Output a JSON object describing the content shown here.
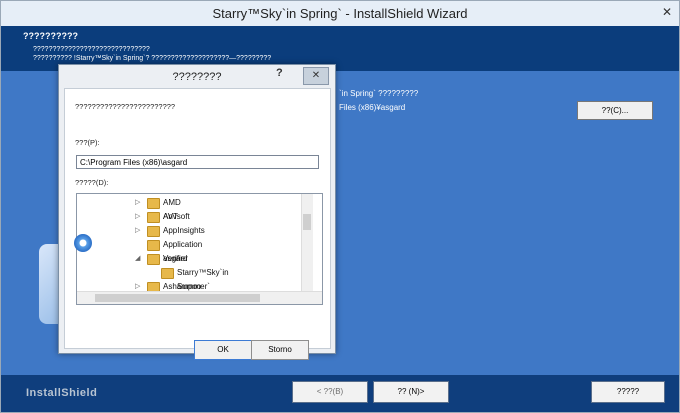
{
  "window": {
    "title": "Starry™Sky`in Spring` - InstallShield Wizard",
    "close_label": "✕"
  },
  "header": {
    "title": "??????????",
    "line1": "??????????????????????????????",
    "line2": "?????????? !Starry™Sky`in Spring`? ????????????????????—?????????"
  },
  "panel": {
    "line1": "`in Spring` ?????????",
    "line2": "Files (x86)¥asgard",
    "change_button": "??(C)..."
  },
  "footer": {
    "brand": "InstallShield",
    "back_button": "< ??(B)",
    "next_button": "?? (N)>",
    "cancel_button": "?????"
  },
  "dialog": {
    "title": "????????",
    "help": "?",
    "close": "✕",
    "prompt": "????????????????????????",
    "path_label": "???(P):",
    "path_value": "C:\\Program Files (x86)\\asgard",
    "dir_label": "?????(D):",
    "tree": [
      {
        "label": "AMD AVT",
        "arrow": "▷",
        "indent": 1
      },
      {
        "label": "Anvsoft",
        "arrow": "▷",
        "indent": 1
      },
      {
        "label": "AppInsights",
        "arrow": "▷",
        "indent": 1
      },
      {
        "label": "Application Verifier",
        "arrow": "",
        "indent": 1
      },
      {
        "label": "asgard",
        "arrow": "◢",
        "indent": 1
      },
      {
        "label": "Starry™Sky`in Summer`",
        "arrow": "",
        "indent": 2
      },
      {
        "label": "Ashampoo",
        "arrow": "▷",
        "indent": 1
      }
    ],
    "ok_button": "OK",
    "storno_button": "Storno"
  }
}
